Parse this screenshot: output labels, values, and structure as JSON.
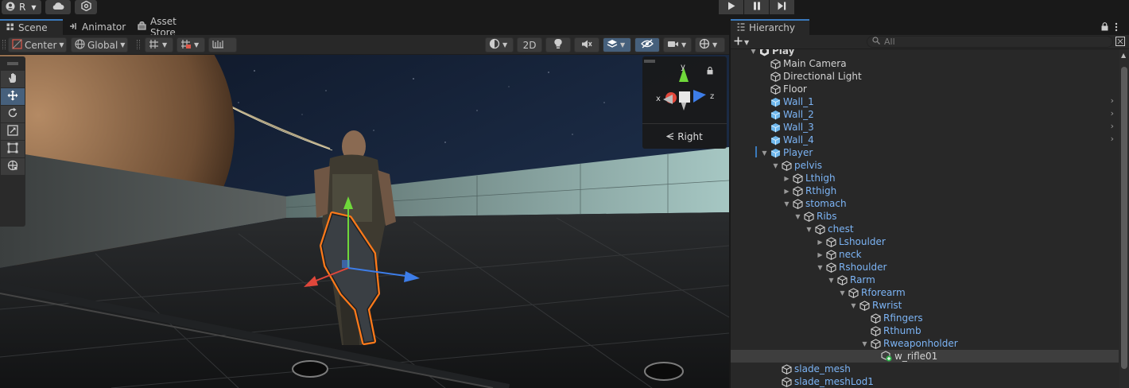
{
  "topbar": {
    "account_label": "R",
    "icons": [
      "account-icon",
      "cloud-icon",
      "settings-icon",
      "play-icon",
      "pause-icon",
      "step-icon"
    ]
  },
  "scene_panel": {
    "tabs": [
      {
        "label": "Scene",
        "icon": "scene-icon",
        "active": true
      },
      {
        "label": "Animator",
        "icon": "animator-icon",
        "active": false
      },
      {
        "label": "Asset Store",
        "icon": "asset-store-icon",
        "active": false
      }
    ],
    "toolbar": {
      "pivot_label": "Center",
      "space_label": "Global",
      "view_2d_label": "2D"
    },
    "tools": [
      "hand-tool",
      "move-tool",
      "rotate-tool",
      "scale-tool",
      "rect-tool",
      "transform-tool"
    ],
    "active_tool": "move-tool",
    "orientation_gizmo": {
      "axis_x": "x",
      "axis_y": "y",
      "axis_z": "z",
      "view_label": "Right"
    }
  },
  "hierarchy": {
    "tab_label": "Hierarchy",
    "search_placeholder": "All",
    "rows": [
      {
        "label": "Play",
        "depth": 0,
        "arrow": "expanded",
        "color": "white",
        "icon": "unity-scene-icon"
      },
      {
        "label": "Main Camera",
        "depth": 1,
        "arrow": "none",
        "color": "white",
        "icon": "gameobject-icon"
      },
      {
        "label": "Directional Light",
        "depth": 1,
        "arrow": "none",
        "color": "white",
        "icon": "gameobject-icon"
      },
      {
        "label": "Floor",
        "depth": 1,
        "arrow": "none",
        "color": "white",
        "icon": "gameobject-icon"
      },
      {
        "label": "Wall_1",
        "depth": 1,
        "arrow": "none",
        "color": "blue",
        "icon": "prefab-icon",
        "chevron": true
      },
      {
        "label": "Wall_2",
        "depth": 1,
        "arrow": "none",
        "color": "blue",
        "icon": "prefab-icon",
        "chevron": true
      },
      {
        "label": "Wall_3",
        "depth": 1,
        "arrow": "none",
        "color": "blue",
        "icon": "prefab-icon",
        "chevron": true
      },
      {
        "label": "Wall_4",
        "depth": 1,
        "arrow": "none",
        "color": "blue",
        "icon": "prefab-icon",
        "chevron": true
      },
      {
        "label": "Player",
        "depth": 1,
        "arrow": "expanded",
        "color": "blue",
        "icon": "prefab-icon"
      },
      {
        "label": "pelvis",
        "depth": 2,
        "arrow": "expanded",
        "color": "blue",
        "icon": "gameobject-icon"
      },
      {
        "label": "Lthigh",
        "depth": 3,
        "arrow": "collapsed",
        "color": "blue",
        "icon": "gameobject-icon"
      },
      {
        "label": "Rthigh",
        "depth": 3,
        "arrow": "collapsed",
        "color": "blue",
        "icon": "gameobject-icon"
      },
      {
        "label": "stomach",
        "depth": 3,
        "arrow": "expanded",
        "color": "blue",
        "icon": "gameobject-icon"
      },
      {
        "label": "Ribs",
        "depth": 4,
        "arrow": "expanded",
        "color": "blue",
        "icon": "gameobject-icon"
      },
      {
        "label": "chest",
        "depth": 5,
        "arrow": "expanded",
        "color": "blue",
        "icon": "gameobject-icon"
      },
      {
        "label": "Lshoulder",
        "depth": 6,
        "arrow": "collapsed",
        "color": "blue",
        "icon": "gameobject-icon"
      },
      {
        "label": "neck",
        "depth": 6,
        "arrow": "collapsed",
        "color": "blue",
        "icon": "gameobject-icon"
      },
      {
        "label": "Rshoulder",
        "depth": 6,
        "arrow": "expanded",
        "color": "blue",
        "icon": "gameobject-icon"
      },
      {
        "label": "Rarm",
        "depth": 7,
        "arrow": "expanded",
        "color": "blue",
        "icon": "gameobject-icon"
      },
      {
        "label": "Rforearm",
        "depth": 8,
        "arrow": "expanded",
        "color": "blue",
        "icon": "gameobject-icon"
      },
      {
        "label": "Rwrist",
        "depth": 9,
        "arrow": "expanded",
        "color": "blue",
        "icon": "gameobject-icon"
      },
      {
        "label": "Rfingers",
        "depth": 10,
        "arrow": "none",
        "color": "blue",
        "icon": "gameobject-icon"
      },
      {
        "label": "Rthumb",
        "depth": 10,
        "arrow": "none",
        "color": "blue",
        "icon": "gameobject-icon"
      },
      {
        "label": "Rweaponholder",
        "depth": 10,
        "arrow": "expanded",
        "color": "blue",
        "icon": "gameobject-icon"
      },
      {
        "label": "w_rifle01",
        "depth": 11,
        "arrow": "none",
        "color": "white",
        "icon": "added-gameobject-icon",
        "selected": true
      },
      {
        "label": "slade_mesh",
        "depth": 2,
        "arrow": "none",
        "color": "blue",
        "icon": "gameobject-icon"
      },
      {
        "label": "slade_meshLod1",
        "depth": 2,
        "arrow": "none",
        "color": "blue",
        "icon": "gameobject-icon"
      }
    ]
  },
  "colors": {
    "accent": "#3a79bb",
    "prefab_text": "#7cb4f5",
    "selection_outline": "#ff7a1a",
    "axis_x": "#e0473b",
    "axis_y": "#6fd83a",
    "axis_z": "#3d7de8"
  }
}
